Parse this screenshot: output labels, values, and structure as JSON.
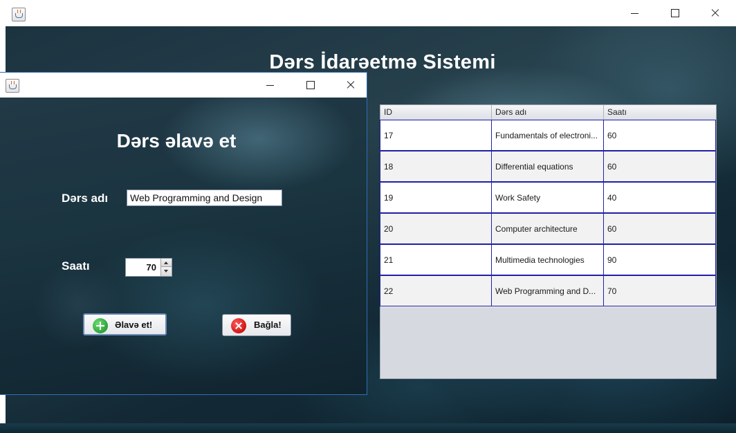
{
  "main_window": {
    "title": "Dərs İdarəetmə Sistemi",
    "icon": "java-cup-icon",
    "controls": {
      "minimize": "minimize-icon",
      "maximize": "maximize-icon",
      "close": "close-icon"
    }
  },
  "table": {
    "columns": [
      "ID",
      "Dərs adı",
      "Saatı"
    ],
    "rows": [
      {
        "id": "17",
        "name": "Fundamentals of electroni...",
        "hours": "60"
      },
      {
        "id": "18",
        "name": "Differential equations",
        "hours": "60"
      },
      {
        "id": "19",
        "name": "Work Safety",
        "hours": "40"
      },
      {
        "id": "20",
        "name": "Computer architecture",
        "hours": "60"
      },
      {
        "id": "21",
        "name": "Multimedia technologies",
        "hours": "90"
      },
      {
        "id": "22",
        "name": "Web Programming and D...",
        "hours": "70"
      }
    ]
  },
  "dialog": {
    "title": "Dərs əlavə et",
    "lesson_label": "Dərs adı",
    "lesson_value": "Web Programming and Design",
    "hours_label": "Saatı",
    "hours_value": "70",
    "add_button": "Əlavə et!",
    "close_button": "Bağla!"
  },
  "colors": {
    "table_grid": "#1f1fa6",
    "table_alt_row": "#f2f2f2",
    "table_empty_bg": "#d6d9e0"
  }
}
